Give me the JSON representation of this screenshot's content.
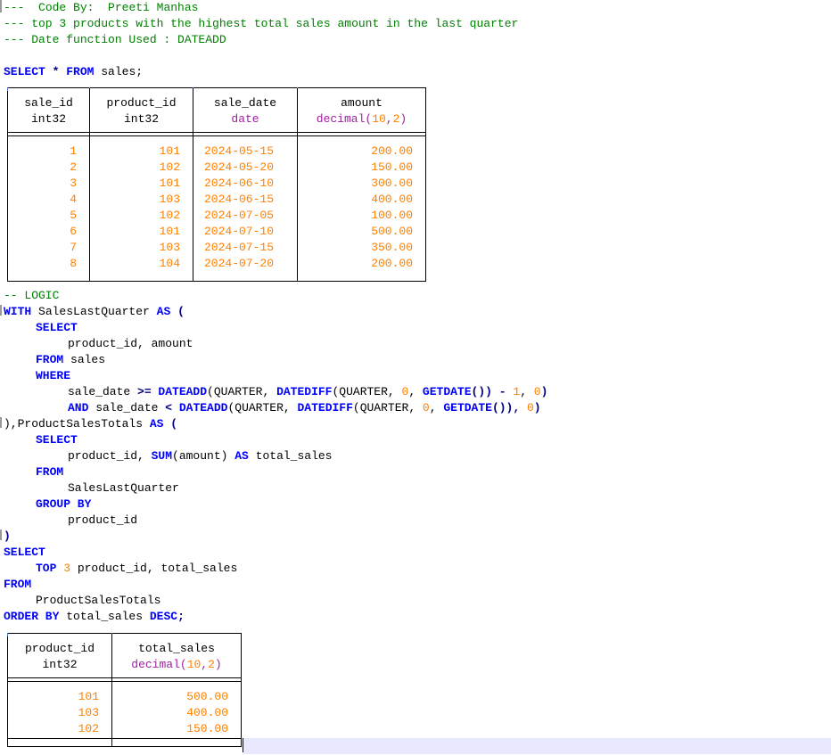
{
  "header": {
    "line1_prefix": "---  ",
    "line1_label": "Code By:",
    "line1_name": "Preeti Manhas",
    "line2": "--- top 3 products with the highest total sales amount in the last quarter",
    "line3": "--- Date function Used : DATEADD"
  },
  "select_all": {
    "kw1": "SELECT",
    "star": " * ",
    "kw2": "FROM",
    "rest": " sales;"
  },
  "sales_table": {
    "columns": [
      {
        "name": "sale_id",
        "type": "int32"
      },
      {
        "name": "product_id",
        "type": "int32"
      },
      {
        "name": "sale_date",
        "type": "date"
      },
      {
        "name": "amount",
        "type_prefix": "decimal(",
        "type_num1": "10",
        "type_comma": ",",
        "type_num2": "2",
        "type_suffix": ")"
      }
    ],
    "rows": [
      [
        "1",
        "101",
        "2024-05-15",
        "200.00"
      ],
      [
        "2",
        "102",
        "2024-05-20",
        "150.00"
      ],
      [
        "3",
        "101",
        "2024-06-10",
        "300.00"
      ],
      [
        "4",
        "103",
        "2024-06-15",
        "400.00"
      ],
      [
        "5",
        "102",
        "2024-07-05",
        "100.00"
      ],
      [
        "6",
        "101",
        "2024-07-10",
        "500.00"
      ],
      [
        "7",
        "103",
        "2024-07-15",
        "350.00"
      ],
      [
        "8",
        "104",
        "2024-07-20",
        "200.00"
      ]
    ]
  },
  "logic": {
    "comment": "-- LOGIC",
    "with_kw": "WITH",
    "cte1_name": " SalesLastQuarter ",
    "as_kw": "AS",
    "open": " (",
    "select_kw": "SELECT",
    "cols1": "product_id, amount",
    "from_kw": "FROM",
    "from1": " sales",
    "where_kw": "WHERE",
    "w1_col": "sale_date ",
    "w1_op": ">=",
    "w1_fn": " DATEADD",
    "w1_a": "(QUARTER, ",
    "w1_fn2": "DATEDIFF",
    "w1_b": "(QUARTER, ",
    "w1_zero": "0",
    "w1_c": ", ",
    "w1_fn3": "GETDATE",
    "w1_d": "()) ",
    "w1_minus": "-",
    "w1_sp": " ",
    "w1_one": "1",
    "w1_e": ", ",
    "w1_zero2": "0",
    "w1_f": ")",
    "and_kw": "AND",
    "w2_col": " sale_date ",
    "w2_op": "<",
    "w2_fn": " DATEADD",
    "w2_a": "(QUARTER, ",
    "w2_fn2": "DATEDIFF",
    "w2_b": "(QUARTER, ",
    "w2_zero": "0",
    "w2_c": ", ",
    "w2_fn3": "GETDATE",
    "w2_d": "()), ",
    "w2_zero2": "0",
    "w2_e": ")",
    "close2": "),ProductSalesTotals ",
    "as_kw2": "AS",
    "open2": " (",
    "select_kw2": "SELECT",
    "cols2_a": "product_id, ",
    "sum_fn": "SUM",
    "cols2_b": "(amount) ",
    "as_kw3": "AS",
    "cols2_c": " total_sales",
    "from_kw2": "FROM",
    "from2": "SalesLastQuarter",
    "group_kw": "GROUP BY",
    "group_col": "product_id",
    "close3": ")",
    "select_kw3": "SELECT",
    "top_kw": "TOP",
    "top_num": "3",
    "top_rest": " product_id, total_sales",
    "from_kw3": "FROM",
    "from3": "ProductSalesTotals",
    "order_kw": "ORDER BY",
    "order_col": " total_sales ",
    "desc_kw": "DESC",
    "semi": ";"
  },
  "result_table": {
    "columns": [
      {
        "name": "product_id",
        "type": "int32"
      },
      {
        "name": "total_sales",
        "type_prefix": "decimal(",
        "type_num1": "10",
        "type_comma": ",",
        "type_num2": "2",
        "type_suffix": ")"
      }
    ],
    "rows": [
      [
        "101",
        "500.00"
      ],
      [
        "103",
        "400.00"
      ],
      [
        "102",
        "150.00"
      ]
    ]
  },
  "colors": {
    "keyword": "#0000ff",
    "comment": "#008000",
    "number": "#ff8000",
    "type": "#a020a0"
  }
}
